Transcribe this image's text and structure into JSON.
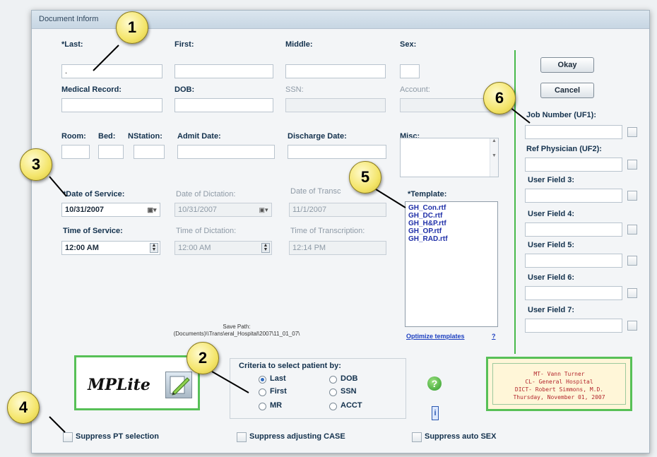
{
  "window": {
    "title": "Document Inform"
  },
  "fields": {
    "last": {
      "label": "*Last:",
      "value": "."
    },
    "first": {
      "label": "First:",
      "value": ""
    },
    "middle": {
      "label": "Middle:",
      "value": ""
    },
    "sex": {
      "label": "Sex:",
      "value": ""
    },
    "medical_record": {
      "label": "Medical Record:",
      "value": ""
    },
    "dob": {
      "label": "DOB:",
      "value": ""
    },
    "ssn": {
      "label": "SSN:",
      "value": ""
    },
    "account": {
      "label": "Account:",
      "value": ""
    },
    "room": {
      "label": "Room:"
    },
    "bed": {
      "label": "Bed:"
    },
    "nstation": {
      "label": "NStation:"
    },
    "admit_date": {
      "label": "Admit Date:"
    },
    "discharge_date": {
      "label": "Discharge Date:"
    },
    "misc": {
      "label": "Misc:"
    },
    "date_of_service": {
      "label": "*Date of Service:",
      "value": "10/31/2007"
    },
    "date_of_dictation": {
      "label": "Date of Dictation:",
      "value": "10/31/2007"
    },
    "date_of_transcription": {
      "label": "Date of Transc",
      "value": "11/1/2007"
    },
    "time_of_service": {
      "label": "Time of Service:",
      "value": "12:00 AM"
    },
    "time_of_dictation": {
      "label": "Time of Dictation:",
      "value": "12:00 AM"
    },
    "time_of_transcription": {
      "label": "Time of Transcription:",
      "value": "12:14 PM"
    }
  },
  "template": {
    "label": "*Template:",
    "items": [
      "GH_Con.rtf",
      "GH_DC.rtf",
      "GH_H&P.rtf",
      "GH_OP.rtf",
      "GH_RAD.rtf"
    ],
    "optimize_link": "Optimize templates",
    "help_link": "?"
  },
  "buttons": {
    "okay": "Okay",
    "cancel": "Cancel"
  },
  "user_fields": [
    {
      "label": "Job Number (UF1):"
    },
    {
      "label": "Ref Physician (UF2):"
    },
    {
      "label": "User Field 3:"
    },
    {
      "label": "User Field 4:"
    },
    {
      "label": "User Field 5:"
    },
    {
      "label": "User Field 6:"
    },
    {
      "label": "User Field 7:"
    }
  ],
  "save_path": {
    "label": "Save Path:",
    "value": "(Documents)\\\\Trans\\eral_Hospital\\2007\\11_01_07\\"
  },
  "logo": {
    "text": "MPLite"
  },
  "criteria": {
    "title": "Criteria to select patient by:",
    "options": [
      "Last",
      "First",
      "MR",
      "DOB",
      "SSN",
      "ACCT"
    ],
    "selected": "Last"
  },
  "info": {
    "lines": [
      "MT-  Vann Turner",
      "CL-  General Hospital",
      "DICT-  Robert Simmons, M.D.",
      "Thursday, November 01, 2007"
    ]
  },
  "checkboxes": {
    "suppress_pt": "Suppress PT selection",
    "suppress_case": "Suppress adjusting CASE",
    "suppress_sex": "Suppress auto SEX"
  },
  "callouts": [
    "1",
    "2",
    "3",
    "4",
    "5",
    "6"
  ],
  "icons": {
    "help": "question-icon",
    "info": "info-icon",
    "pencil": "pencil-icon",
    "calendar": "calendar-dropdown-icon",
    "spinner": "spinner-icon"
  }
}
